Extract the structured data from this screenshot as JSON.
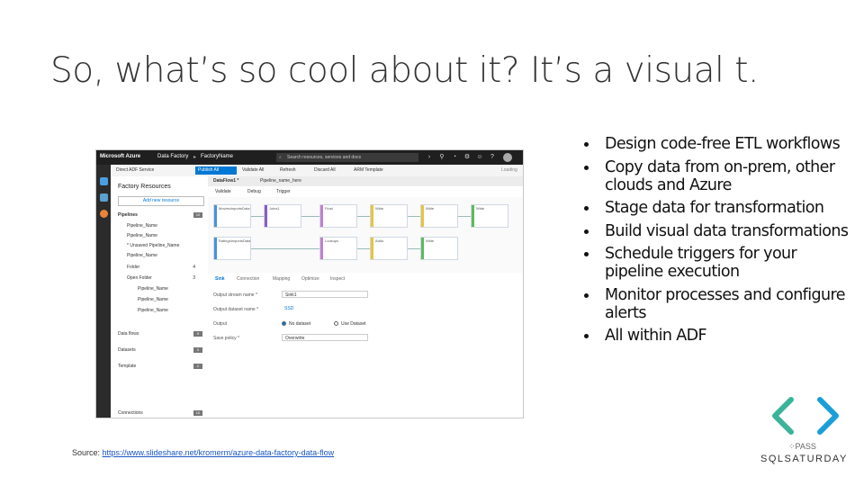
{
  "slide": {
    "title": "So, what’s so cool about it? It’s a visual t.",
    "bullets": [
      "Design code-free ETL workflows",
      "Copy data from on-prem, other clouds and Azure",
      "Stage data for transformation",
      "Build visual data transformations",
      "Schedule triggers for your pipeline execution",
      "Monitor processes and configure alerts",
      "All within ADF"
    ],
    "source_label": "Source:",
    "source_link": "https://www.slideshare.net/kromerm/azure-data-factory-data-flow",
    "logo": {
      "pass_text": "PASS",
      "brand_text": "SQLSATURDAY",
      "colors": {
        "left": "#3bb39a",
        "right": "#1a9fd8"
      }
    }
  },
  "screenshot": {
    "topbar": {
      "brand": "Microsoft Azure",
      "crumb1": "Data Factory",
      "crumb2": "FactoryName",
      "search_placeholder": "Search resources, services and docs"
    },
    "toolbar": {
      "direct": "Direct ADF Service",
      "publish": "Publish All",
      "validate": "Validate All",
      "refresh": "Refresh",
      "discard": "Discard All",
      "arm": "ARM Template",
      "loading": "Loading"
    },
    "factory": {
      "header": "Factory Resources",
      "add_resource": "Add new resource",
      "pipelines": "Pipelines",
      "pipelines_count": "10",
      "items": [
        "Pipeline_Name",
        "Pipeline_Name",
        "* Unsaved Pipeline_Name",
        "Pipeline_Name"
      ],
      "folder": "Folder",
      "folder_count": "4",
      "open_folder": "Open Folder",
      "open_folder_count": "3",
      "sub_items": [
        "Pipeline_Name",
        "Pipeline_Name",
        "Pipeline_Name"
      ],
      "data_flows": "Data flows",
      "data_flows_count": "5",
      "datasets": "Datasets",
      "datasets_count": "0",
      "template": "Template",
      "template_count": "2",
      "connections": "Connections",
      "connections_count": "10"
    },
    "tabs": [
      "DataFlow1 *",
      "Pipeline_name_here"
    ],
    "canvas_toolbar": {
      "validate": "Validate",
      "debug": "Debug",
      "trigger": "Trigger"
    },
    "nodes_row1": [
      "MoviesImportsData",
      "Joins1",
      "Final",
      "Wide",
      "Wide",
      "Wide"
    ],
    "nodes_row2": [
      "RatingsImportsData",
      "",
      "Lookups",
      "Addo",
      "Wide"
    ],
    "prop_tabs": [
      "Sink",
      "Connection",
      "Mapping",
      "Optimize",
      "Inspect"
    ],
    "props": {
      "output_stream_label": "Output stream name *",
      "output_stream_value": "Sink1",
      "output_dataset_label": "Output dataset name *",
      "output_dataset_value": "SSD",
      "output_label": "Output",
      "radio_no_dataset": "No dataset",
      "radio_use_dataset": "Use Dataset",
      "save_policy_label": "Save policy *",
      "save_policy_value": "Overwrite"
    }
  }
}
